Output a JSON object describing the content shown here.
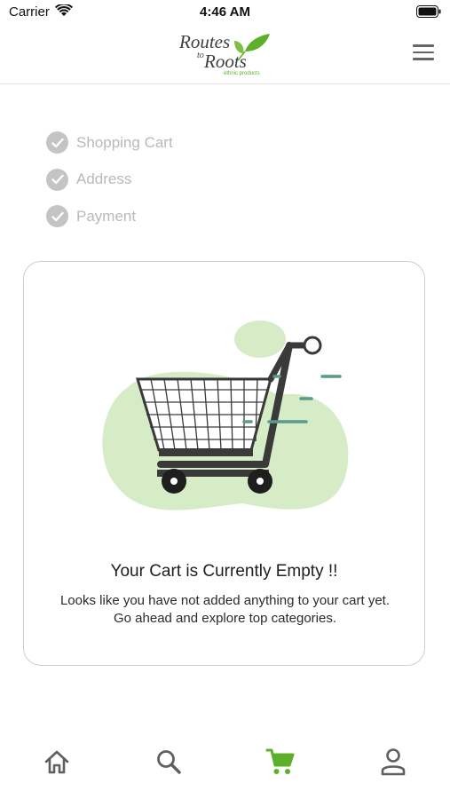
{
  "status_bar": {
    "carrier": "Carrier",
    "time": "4:46 AM"
  },
  "header": {
    "logo_line1": "Routes",
    "logo_line2": "to",
    "logo_line3": "Roots",
    "logo_tagline": "ethnic products"
  },
  "steps": [
    {
      "label": "Shopping Cart",
      "completed": true
    },
    {
      "label": "Address",
      "completed": true
    },
    {
      "label": "Payment",
      "completed": true
    }
  ],
  "empty_cart": {
    "title": "Your Cart is Currently Empty !!",
    "message": "Looks like you have not added anything to your cart yet. Go ahead and explore top categories."
  },
  "bottom_nav": {
    "items": [
      {
        "icon": "home-icon",
        "active": false
      },
      {
        "icon": "search-icon",
        "active": false
      },
      {
        "icon": "cart-icon",
        "active": true
      },
      {
        "icon": "profile-icon",
        "active": false
      }
    ]
  },
  "colors": {
    "accent": "#5db02a",
    "blob": "#d6ecc6",
    "cart_dark": "#3a3a3a",
    "speed_lines": "#5a9a8a",
    "inactive_icon": "#5f5f5f",
    "step_gray": "#c4c4c4"
  }
}
